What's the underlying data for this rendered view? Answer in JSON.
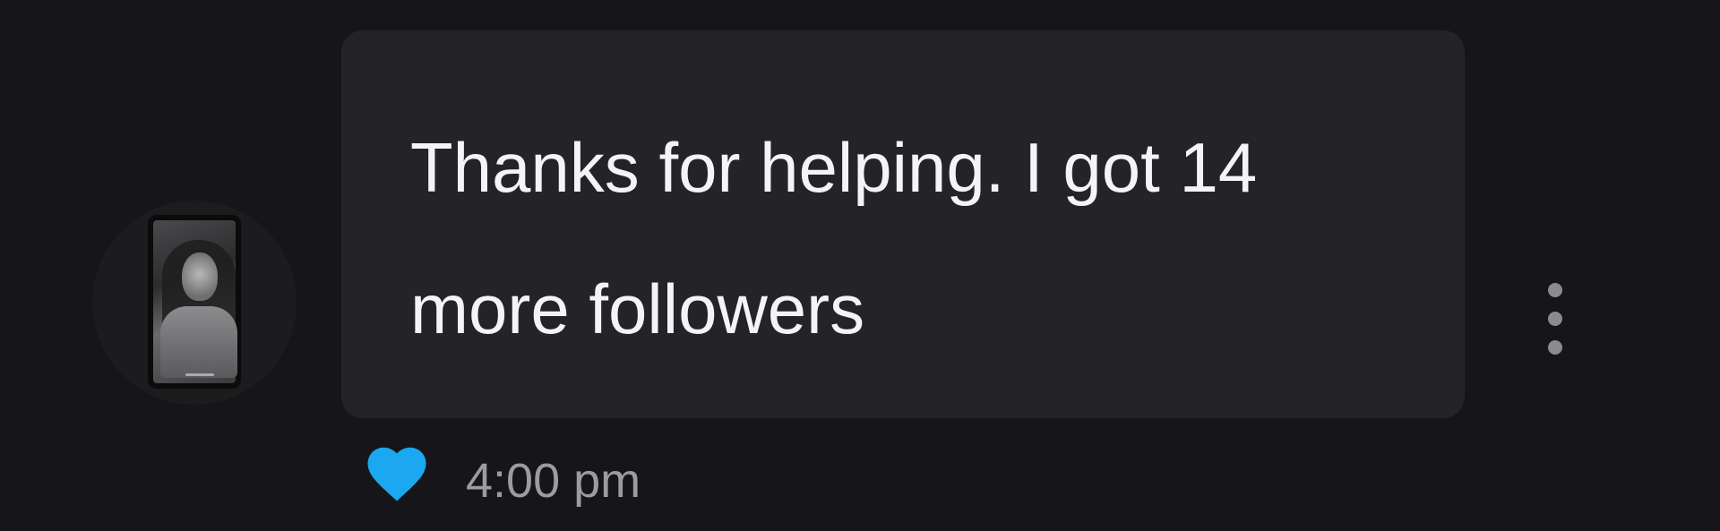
{
  "message": {
    "text": "Thanks for helping. I got 14 more followers",
    "timestamp": "4:00 pm",
    "liked": true
  },
  "sender": {
    "avatar_icon": "profile-photo"
  },
  "icons": {
    "like": "heart-icon",
    "more": "more-vertical-icon"
  },
  "colors": {
    "background": "#16161a",
    "bubble": "#242428",
    "text": "#f4f4f6",
    "timestamp": "#9b9ca1",
    "heart": "#1ba8f0",
    "menu_dots": "#8a8b90"
  }
}
